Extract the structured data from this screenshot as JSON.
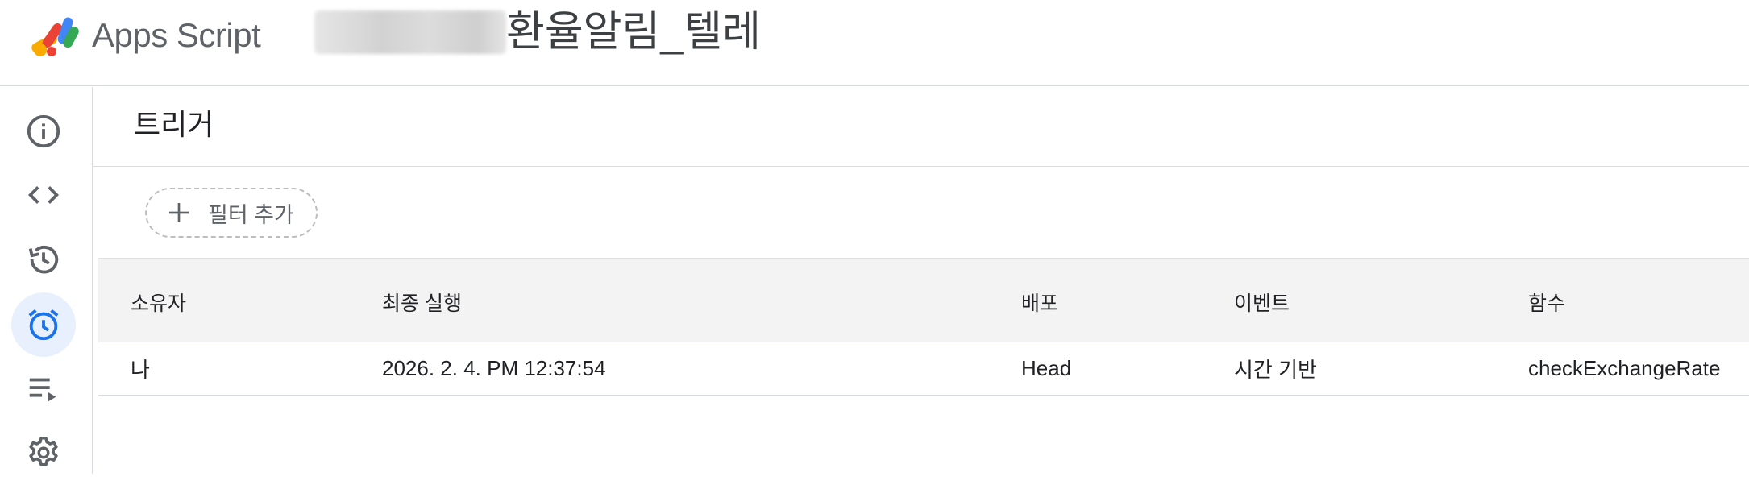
{
  "header": {
    "app_name": "Apps Script",
    "project_name": "환율알림_텔레"
  },
  "rail": {
    "items": [
      {
        "icon": "info-icon",
        "label": "개요"
      },
      {
        "icon": "code-icon",
        "label": "편집기"
      },
      {
        "icon": "history-icon",
        "label": "프로젝트 기록"
      },
      {
        "icon": "alarm-icon",
        "label": "트리거",
        "active": true
      },
      {
        "icon": "executions-icon",
        "label": "실행"
      },
      {
        "icon": "gear-icon",
        "label": "프로젝트 설정"
      }
    ]
  },
  "main": {
    "page_title": "트리거",
    "filter_button_label": "필터 추가",
    "table": {
      "columns": [
        "소유자",
        "최종 실행",
        "배포",
        "이벤트",
        "함수"
      ],
      "rows": [
        {
          "owner": "나",
          "last_run": "2026. 2. 4. PM 12:37:54",
          "deployment": "Head",
          "event": "시간 기반",
          "function": "checkExchangeRate"
        }
      ]
    }
  },
  "colors": {
    "active_rail_bg": "#e8f0fe",
    "active_icon": "#1a73e8",
    "icon_gray": "#5f6368",
    "header_row_bg": "#f3f3f3",
    "divider": "#dadce0"
  }
}
